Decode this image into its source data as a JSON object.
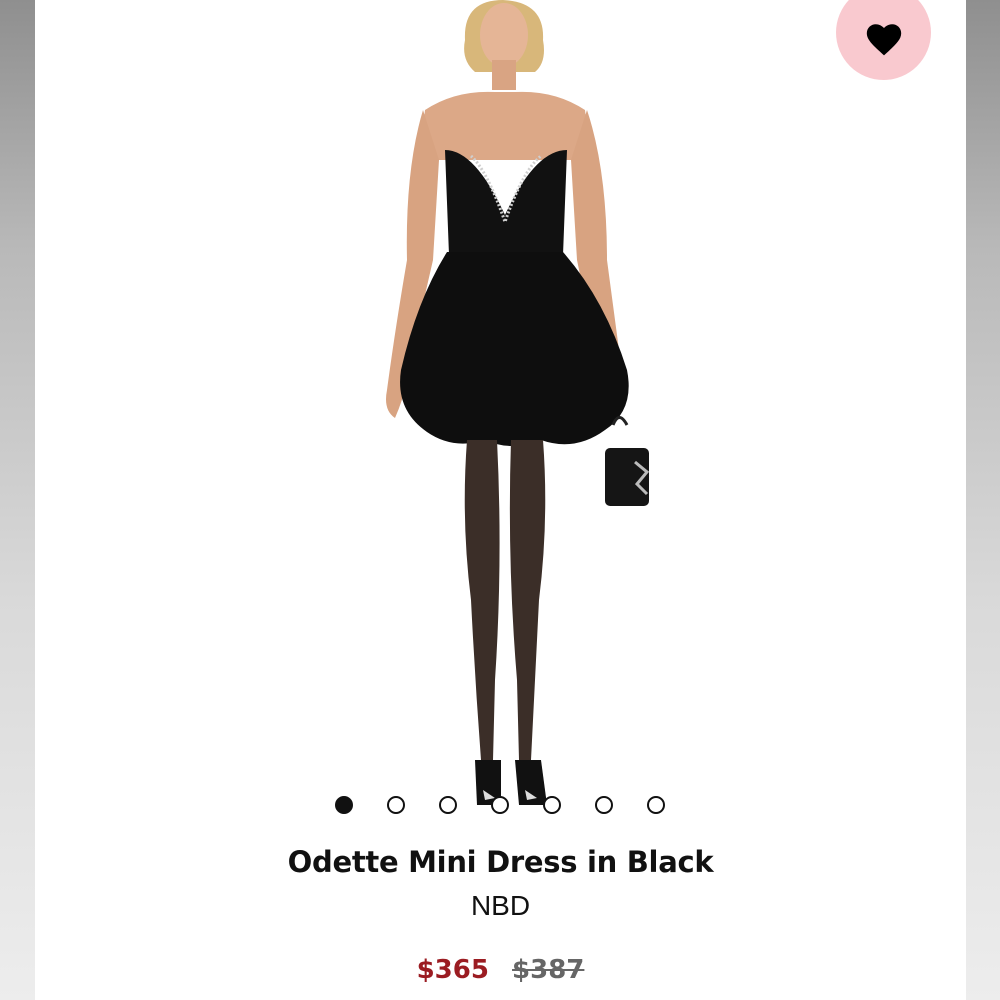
{
  "product": {
    "title": "Odette Mini Dress in Black",
    "brand": "NBD",
    "price_current": "$365",
    "price_original": "$387"
  },
  "wishlist": {
    "icon": "heart-icon",
    "state": "active"
  },
  "carousel": {
    "total_images": 7,
    "active_index": 0
  },
  "colors": {
    "accent_price": "#9b1c22",
    "wishlist_bg": "#f9c9cf",
    "text": "#111111"
  }
}
